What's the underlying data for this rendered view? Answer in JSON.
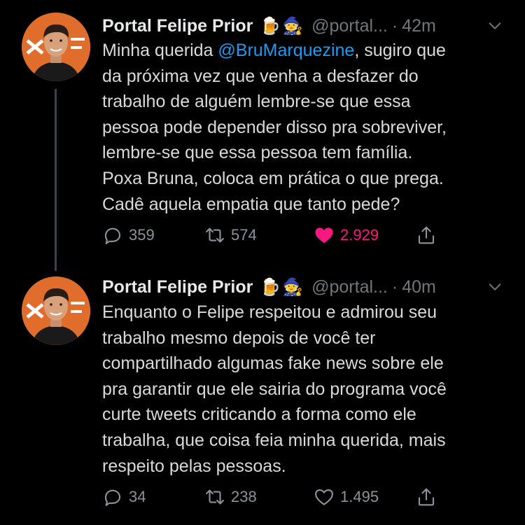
{
  "colors": {
    "background": "#000000",
    "text": "#d9d9d9",
    "muted": "#71767b",
    "mention": "#1d9bf0",
    "like_active": "#f91880",
    "avatar_bg": "#e06d2c"
  },
  "tweets": [
    {
      "display_name": "Portal Felipe Prior",
      "emoji": "🍺🧙",
      "handle": "@portal...",
      "time": "42m",
      "text_lines": [
        {
          "pre": "Minha querida ",
          "mention": "@BruMarquezine",
          "post": ", sugiro que"
        },
        {
          "pre": "da próxima vez que venha a desfazer do"
        },
        {
          "pre": "trabalho de alguém lembre-se que essa"
        },
        {
          "pre": "pessoa pode depender disso pra sobreviver,"
        },
        {
          "pre": "lembre-se que essa pessoa tem família."
        },
        {
          "pre": "Poxa Bruna, coloca em prática o que prega."
        },
        {
          "pre": "Cadê aquela empatia que tanto pede?"
        }
      ],
      "replies": "359",
      "retweets": "574",
      "likes": "2.929",
      "liked": true,
      "icons": {
        "reply": "reply-icon",
        "retweet": "retweet-icon",
        "like": "heart-filled-icon",
        "share": "share-icon",
        "menu": "chevron-down-icon"
      }
    },
    {
      "display_name": "Portal Felipe Prior",
      "emoji": "🍺🧙",
      "handle": "@portal...",
      "time": "40m",
      "text_lines": [
        {
          "pre": "Enquanto o Felipe respeitou e admirou seu"
        },
        {
          "pre": "trabalho mesmo depois de você ter"
        },
        {
          "pre": "compartilhado algumas fake news sobre ele"
        },
        {
          "pre": "pra garantir que ele sairia do programa você"
        },
        {
          "pre": "curte tweets criticando a forma como ele"
        },
        {
          "pre": "trabalha, que coisa feia minha querida, mais"
        },
        {
          "pre": "respeito pelas pessoas."
        }
      ],
      "replies": "34",
      "retweets": "238",
      "likes": "1.495",
      "liked": false,
      "icons": {
        "reply": "reply-icon",
        "retweet": "retweet-icon",
        "like": "heart-outline-icon",
        "share": "share-icon",
        "menu": "chevron-down-icon"
      }
    }
  ]
}
